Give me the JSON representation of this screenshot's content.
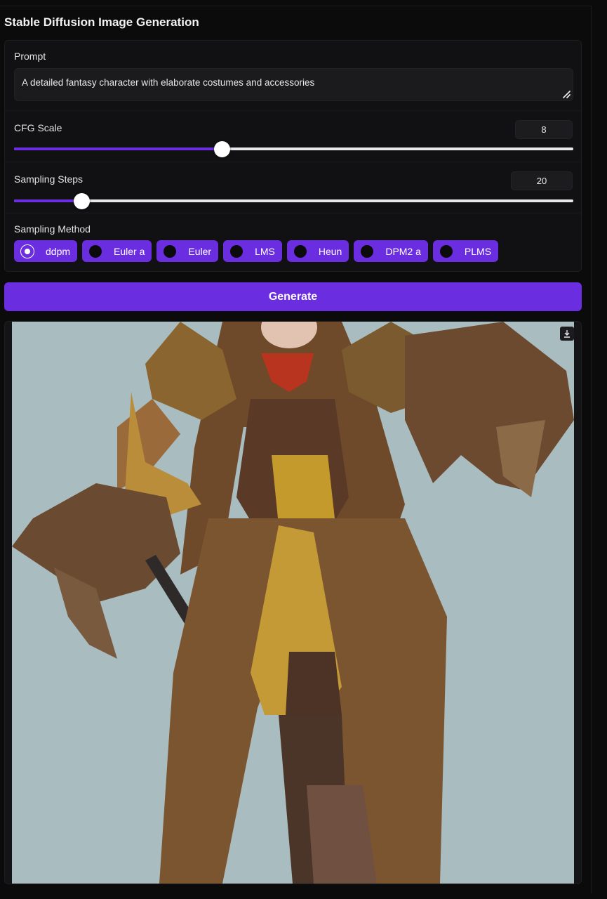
{
  "app": {
    "title": "Stable Diffusion Image Generation"
  },
  "prompt": {
    "label": "Prompt",
    "value": "A detailed fantasy character with elaborate costumes and accessories"
  },
  "cfg_scale": {
    "label": "CFG Scale",
    "value": "8",
    "fill_fraction": 0.371
  },
  "sampling_steps": {
    "label": "Sampling Steps",
    "value": "20",
    "fill_fraction": 0.121
  },
  "sampling_method": {
    "label": "Sampling Method",
    "options": [
      "ddpm",
      "Euler a",
      "Euler",
      "LMS",
      "Heun",
      "DPM2 a",
      "PLMS"
    ],
    "selected": "ddpm"
  },
  "generate_button": {
    "label": "Generate"
  },
  "output": {
    "image_icon": "download-icon"
  },
  "colors": {
    "accent": "#6b2de0",
    "background": "#0b0b0c",
    "panel": "#141416",
    "image_bg": "#a9bcbf"
  }
}
